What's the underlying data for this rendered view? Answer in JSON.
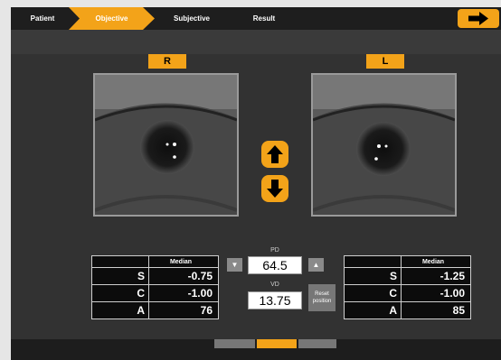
{
  "steps": [
    "Patient",
    "Objective",
    "Subjective",
    "Result"
  ],
  "right_label": "R",
  "left_label": "L",
  "pd": {
    "label": "PD",
    "value": "64.5"
  },
  "vd": {
    "label": "VD",
    "value": "13.75"
  },
  "reset_label": "Reset position",
  "right_table": {
    "header": "Median",
    "rows": [
      {
        "label": "S",
        "value": "-0.75"
      },
      {
        "label": "C",
        "value": "-1.00"
      },
      {
        "label": "A",
        "value": "76"
      }
    ]
  },
  "left_table": {
    "header": "Median",
    "rows": [
      {
        "label": "S",
        "value": "-1.25"
      },
      {
        "label": "C",
        "value": "-1.00"
      },
      {
        "label": "A",
        "value": "85"
      }
    ]
  },
  "colors": {
    "accent": "#f3a319",
    "bar_bg": "#1e1e1e",
    "panel_bg": "#323232"
  },
  "icons": {
    "next": "arrow-right-icon",
    "up": "arrow-up-icon",
    "down": "arrow-down-icon",
    "pd_dec": "triangle-down-icon",
    "pd_inc": "triangle-up-icon"
  }
}
